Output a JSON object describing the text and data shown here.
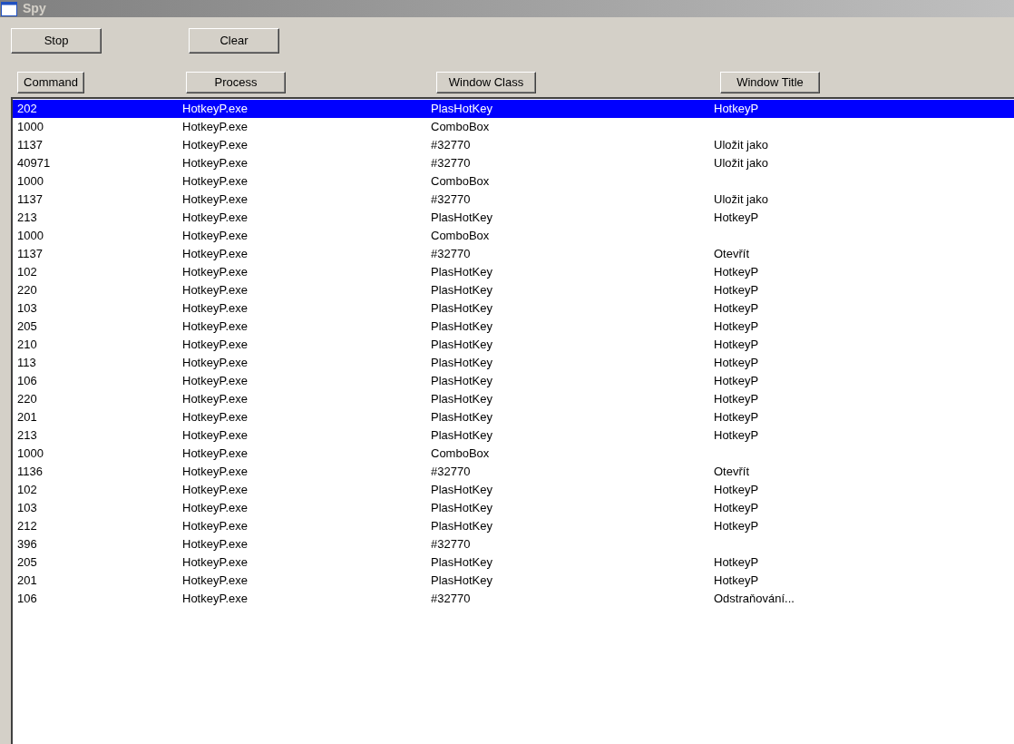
{
  "window": {
    "title": "Spy"
  },
  "buttons": [
    "Stop",
    "Clear"
  ],
  "table": {
    "columns": [
      "Command",
      "Process",
      "Window Class",
      "Window Title"
    ],
    "rows": [
      {
        "cells": [
          "202",
          "HotkeyP.exe",
          "PlasHotKey",
          "HotkeyP"
        ],
        "selected": true
      },
      {
        "cells": [
          "1000",
          "HotkeyP.exe",
          "ComboBox",
          ""
        ],
        "selected": false
      },
      {
        "cells": [
          "1137",
          "HotkeyP.exe",
          "#32770",
          "Uložit jako"
        ],
        "selected": false
      },
      {
        "cells": [
          "40971",
          "HotkeyP.exe",
          "#32770",
          "Uložit jako"
        ],
        "selected": false
      },
      {
        "cells": [
          "1000",
          "HotkeyP.exe",
          "ComboBox",
          ""
        ],
        "selected": false
      },
      {
        "cells": [
          "1137",
          "HotkeyP.exe",
          "#32770",
          "Uložit jako"
        ],
        "selected": false
      },
      {
        "cells": [
          "213",
          "HotkeyP.exe",
          "PlasHotKey",
          "HotkeyP"
        ],
        "selected": false
      },
      {
        "cells": [
          "1000",
          "HotkeyP.exe",
          "ComboBox",
          ""
        ],
        "selected": false
      },
      {
        "cells": [
          "1137",
          "HotkeyP.exe",
          "#32770",
          "Otevřít"
        ],
        "selected": false
      },
      {
        "cells": [
          "102",
          "HotkeyP.exe",
          "PlasHotKey",
          "HotkeyP"
        ],
        "selected": false
      },
      {
        "cells": [
          "220",
          "HotkeyP.exe",
          "PlasHotKey",
          "HotkeyP"
        ],
        "selected": false
      },
      {
        "cells": [
          "103",
          "HotkeyP.exe",
          "PlasHotKey",
          "HotkeyP"
        ],
        "selected": false
      },
      {
        "cells": [
          "205",
          "HotkeyP.exe",
          "PlasHotKey",
          "HotkeyP"
        ],
        "selected": false
      },
      {
        "cells": [
          "210",
          "HotkeyP.exe",
          "PlasHotKey",
          "HotkeyP"
        ],
        "selected": false
      },
      {
        "cells": [
          "113",
          "HotkeyP.exe",
          "PlasHotKey",
          "HotkeyP"
        ],
        "selected": false
      },
      {
        "cells": [
          "106",
          "HotkeyP.exe",
          "PlasHotKey",
          "HotkeyP"
        ],
        "selected": false
      },
      {
        "cells": [
          "220",
          "HotkeyP.exe",
          "PlasHotKey",
          "HotkeyP"
        ],
        "selected": false
      },
      {
        "cells": [
          "201",
          "HotkeyP.exe",
          "PlasHotKey",
          "HotkeyP"
        ],
        "selected": false
      },
      {
        "cells": [
          "213",
          "HotkeyP.exe",
          "PlasHotKey",
          "HotkeyP"
        ],
        "selected": false
      },
      {
        "cells": [
          "1000",
          "HotkeyP.exe",
          "ComboBox",
          ""
        ],
        "selected": false
      },
      {
        "cells": [
          "1136",
          "HotkeyP.exe",
          "#32770",
          "Otevřít"
        ],
        "selected": false
      },
      {
        "cells": [
          "102",
          "HotkeyP.exe",
          "PlasHotKey",
          "HotkeyP"
        ],
        "selected": false
      },
      {
        "cells": [
          "103",
          "HotkeyP.exe",
          "PlasHotKey",
          "HotkeyP"
        ],
        "selected": false
      },
      {
        "cells": [
          "212",
          "HotkeyP.exe",
          "PlasHotKey",
          "HotkeyP"
        ],
        "selected": false
      },
      {
        "cells": [
          "396",
          "HotkeyP.exe",
          "#32770",
          ""
        ],
        "selected": false
      },
      {
        "cells": [
          "205",
          "HotkeyP.exe",
          "PlasHotKey",
          "HotkeyP"
        ],
        "selected": false
      },
      {
        "cells": [
          "201",
          "HotkeyP.exe",
          "PlasHotKey",
          "HotkeyP"
        ],
        "selected": false
      },
      {
        "cells": [
          "106",
          "HotkeyP.exe",
          "#32770",
          "Odstraňování..."
        ],
        "selected": false
      }
    ]
  }
}
